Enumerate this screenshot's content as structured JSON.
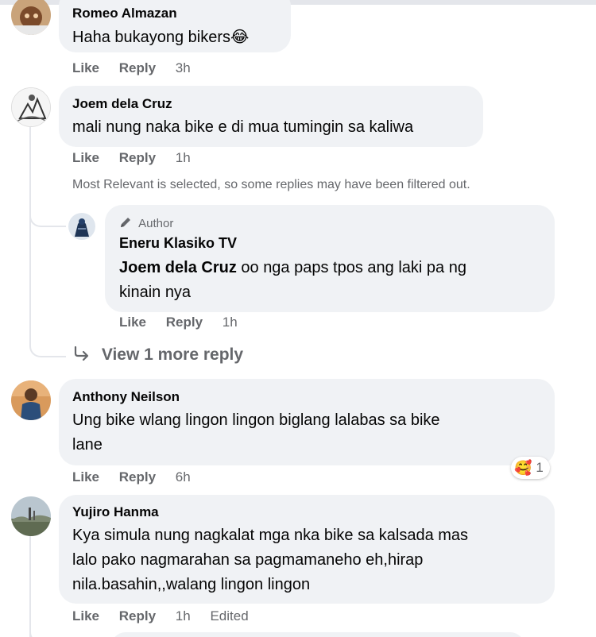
{
  "comments": [
    {
      "author": "Romeo Almazan",
      "text": "Haha bukayong bikers😂",
      "like": "Like",
      "reply": "Reply",
      "time": "3h"
    },
    {
      "author": "Joem dela Cruz",
      "text": "mali nung naka bike e di mua tumingin sa kaliwa",
      "like": "Like",
      "reply": "Reply",
      "time": "1h",
      "filter_note": "Most Relevant is selected, so some replies may have been filtered out.",
      "replies": [
        {
          "badge": "Author",
          "author": "Eneru Klasiko TV",
          "mention": "Joem dela Cruz",
          "text_line1": " oo nga paps tpos ang laki pa ng",
          "text_line2": "kinain nya",
          "like": "Like",
          "reply": "Reply",
          "time": "1h"
        }
      ],
      "view_more": "View 1 more reply"
    },
    {
      "author": "Anthony Neilson",
      "text_line1": "Ung bike wlang lingon lingon biglang lalabas sa bike",
      "text_line2": "lane",
      "like": "Like",
      "reply": "Reply",
      "time": "6h",
      "reaction_emoji": "🥰",
      "reaction_count": "1"
    },
    {
      "author": "Yujiro Hanma",
      "text_line1": "Kya simula nung nagkalat mga nka bike sa kalsada mas",
      "text_line2": "lalo pako nagmarahan sa pagmamaneho eh,hirap",
      "text_line3": "nila.basahin,,walang lingon lingon",
      "like": "Like",
      "reply": "Reply",
      "time": "1h",
      "edited": "Edited"
    }
  ],
  "icons": {
    "reply_arrow": "reply-arrow-icon",
    "author_pen": "pen-icon"
  }
}
